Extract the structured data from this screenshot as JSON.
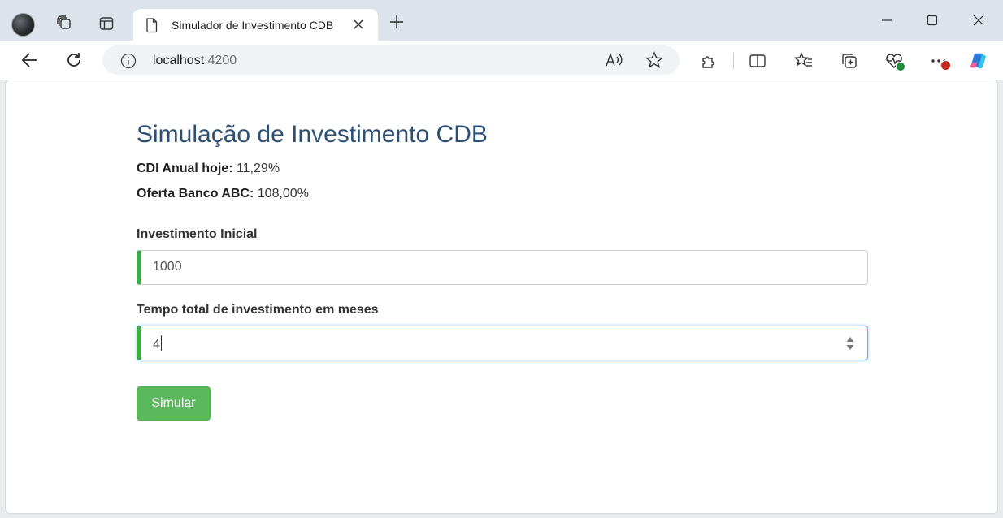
{
  "browser": {
    "tab_title": "Simulador de Investimento CDB",
    "url_host": "localhost",
    "url_port": ":4200"
  },
  "page": {
    "title": "Simulação de Investimento CDB",
    "cdi": {
      "label": "CDI Anual hoje:",
      "value": "11,29%"
    },
    "oferta": {
      "label": "Oferta Banco ABC:",
      "value": "108,00%"
    },
    "investimento_inicial": {
      "label": "Investimento Inicial",
      "value": "1000"
    },
    "tempo_total": {
      "label": "Tempo total de investimento em meses",
      "value": "4"
    },
    "submit_label": "Simular"
  },
  "colors": {
    "title": "#2c5075",
    "valid_border": "#42a948",
    "button_bg": "#5cb85c",
    "focus_border": "#66afe9"
  }
}
